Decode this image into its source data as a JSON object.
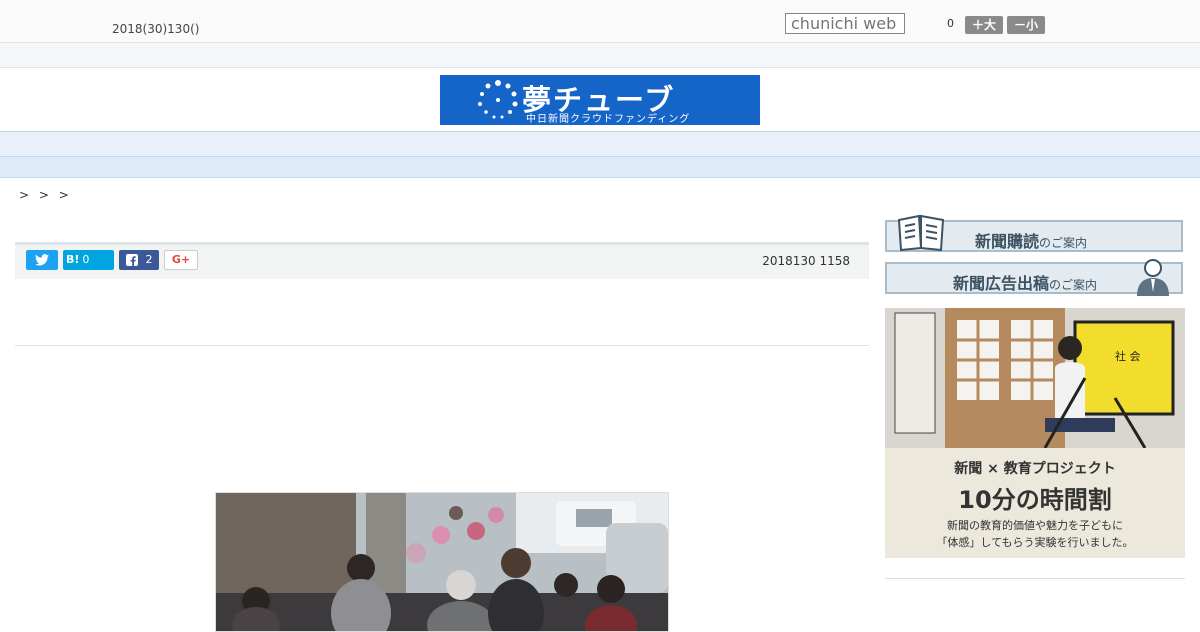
{
  "header": {
    "date": "2018(30)130()",
    "search_placeholder": "chunichi web",
    "font_size_count": "0",
    "font_larger": "＋大",
    "font_smaller": "－小"
  },
  "logo": {
    "title": "夢チューブ",
    "subtitle": "中日新聞クラウドファンディング"
  },
  "nav": {
    "items": [
      "",
      "",
      "",
      "",
      "",
      "",
      "",
      "",
      ""
    ]
  },
  "breadcrumb": "> > >",
  "share": {
    "twitter_icon": "twitter-bird-icon",
    "hatena_label": "B!",
    "hatena_count": "0",
    "facebook_count": "2",
    "gplus_label": "G+"
  },
  "article": {
    "published": "2018130 1158"
  },
  "sidebar": {
    "subscribe_main": "新聞購読",
    "subscribe_suffix": "のご案内",
    "ad_main": "新聞広告出稿",
    "ad_suffix": "のご案内",
    "promo": {
      "line1": "新聞 × 教育プロジェクト",
      "line2": "10分の時間割",
      "line3": "新聞の教育的価値や魅力を子どもに",
      "line4": "「体感」してもらう実験を行いました。",
      "board_text": "社 会"
    }
  },
  "colors": {
    "logo_bg": "#1565c8",
    "nav_bg": "#e8f1fb",
    "twitter": "#1da1f2",
    "hatena": "#00a4de",
    "facebook": "#3b5998"
  }
}
